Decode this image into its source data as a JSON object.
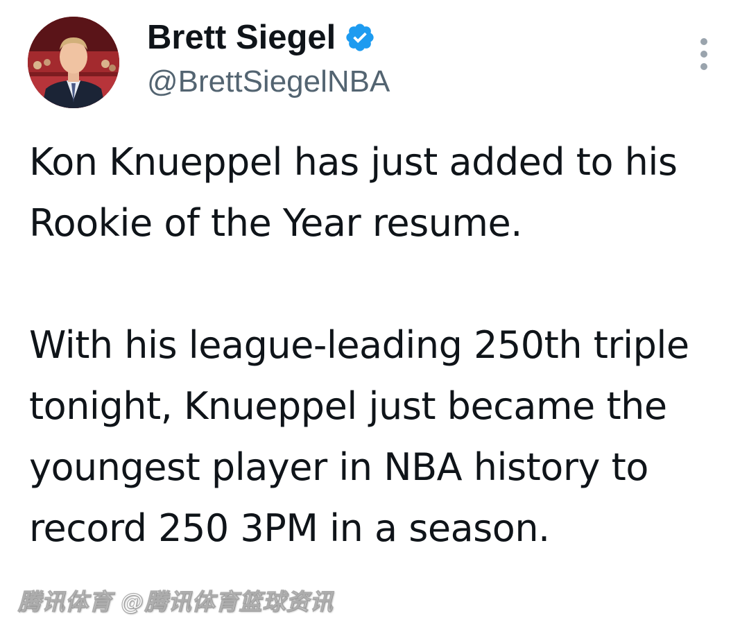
{
  "author": {
    "display_name": "Brett Siegel",
    "handle": "@BrettSiegelNBA",
    "verified": true,
    "verified_icon": "verified-badge-icon",
    "verified_color": "#1d9bf0"
  },
  "menu": {
    "icon": "more-vertical-icon"
  },
  "tweet": {
    "paragraph_1": "Kon Knueppel has just added to his Rookie of the Year resume.",
    "paragraph_2": "With his league-leading 250th triple tonight, Knueppel just became the youngest player in NBA history to record 250 3PM in a season."
  },
  "watermark": {
    "text": "腾讯体育 @腾讯体育篮球资讯"
  },
  "colors": {
    "text_primary": "#0f1419",
    "text_secondary": "#536471",
    "background": "#ffffff"
  }
}
